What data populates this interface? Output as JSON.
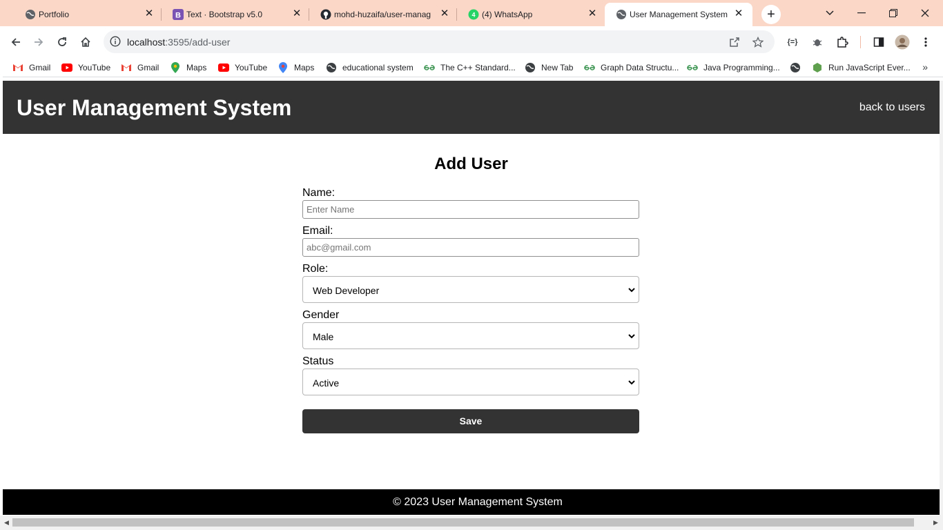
{
  "browser": {
    "tabs": [
      {
        "title": "Portfolio",
        "icon": "globe-icon"
      },
      {
        "title": "Text · Bootstrap v5.0",
        "icon": "bootstrap-icon"
      },
      {
        "title": "mohd-huzaifa/user-manag",
        "icon": "github-icon"
      },
      {
        "title": "(4) WhatsApp",
        "icon": "whatsapp-icon"
      },
      {
        "title": "User Management System",
        "icon": "globe-icon"
      }
    ],
    "close_glyph": "✕",
    "new_tab_glyph": "+",
    "url_host": "localhost",
    "url_rest": ":3595/add-user",
    "bookmarks": [
      {
        "label": "Gmail",
        "icon": "gmail-icon"
      },
      {
        "label": "YouTube",
        "icon": "youtube-icon"
      },
      {
        "label": "Gmail",
        "icon": "gmail-icon"
      },
      {
        "label": "Maps",
        "icon": "maps-icon"
      },
      {
        "label": "YouTube",
        "icon": "youtube-icon"
      },
      {
        "label": "Maps",
        "icon": "maps-icon"
      },
      {
        "label": "educational system",
        "icon": "globe-icon"
      },
      {
        "label": "The C++ Standard...",
        "icon": "geeksforgeeks-icon"
      },
      {
        "label": "New Tab",
        "icon": "globe-icon"
      },
      {
        "label": "Graph Data Structu...",
        "icon": "geeksforgeeks-icon"
      },
      {
        "label": "Java Programming...",
        "icon": "geeksforgeeks-icon"
      },
      {
        "label": "",
        "icon": "globe-icon"
      },
      {
        "label": "Run JavaScript Ever...",
        "icon": "nodejs-icon"
      }
    ],
    "bookmarks_more": "»"
  },
  "app": {
    "title": "User Management System",
    "back_link": "back to users"
  },
  "form": {
    "heading": "Add User",
    "name_label": "Name:",
    "name_placeholder": "Enter Name",
    "email_label": "Email:",
    "email_placeholder": "abc@gmail.com",
    "role_label": "Role:",
    "role_value": "Web Developer",
    "gender_label": "Gender",
    "gender_value": "Male",
    "status_label": "Status",
    "status_value": "Active",
    "save_label": "Save"
  },
  "footer": {
    "text": "© 2023 User Management System"
  },
  "colors": {
    "tabstrip": "#fbd7c8",
    "header_bg": "#333333",
    "button_bg": "#333333",
    "footer_bg": "#000000"
  }
}
